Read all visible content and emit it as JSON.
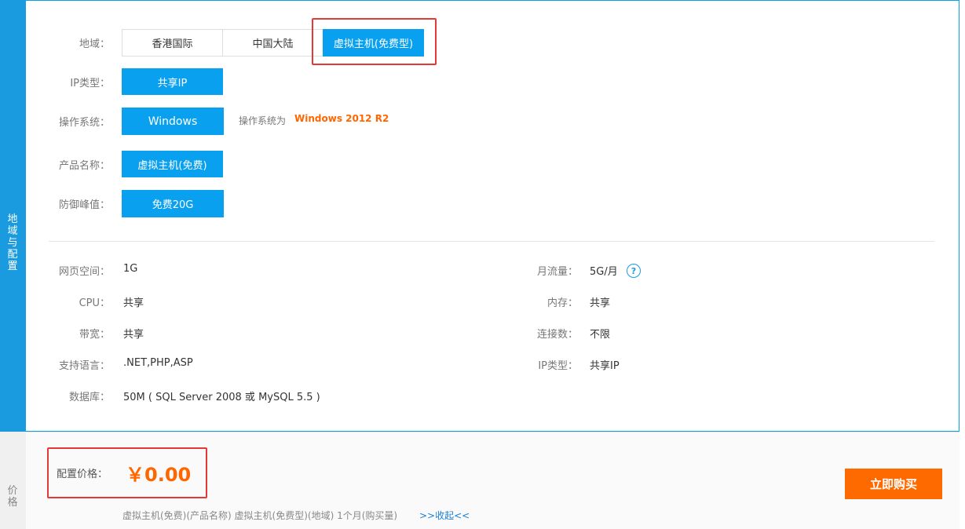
{
  "side_tabs": {
    "config": "地域与配置",
    "price": "价格"
  },
  "region": {
    "label": "地域：",
    "options": [
      "香港国际",
      "中国大陆",
      "虚拟主机(免费型)"
    ],
    "selected": "虚拟主机(免费型)"
  },
  "ip_type": {
    "label": "IP类型：",
    "option": "共享IP"
  },
  "os": {
    "label": "操作系统：",
    "option": "Windows",
    "note": "操作系统为",
    "version": "Windows 2012 R2"
  },
  "product": {
    "label": "产品名称：",
    "option": "虚拟主机(免费)"
  },
  "defense": {
    "label": "防御峰值：",
    "option": "免费20G"
  },
  "specs_left": [
    {
      "label": "网页空间：",
      "value": "1G"
    },
    {
      "label": "CPU：",
      "value": "共享"
    },
    {
      "label": "带宽：",
      "value": "共享"
    },
    {
      "label": "支持语言：",
      "value": ".NET,PHP,ASP"
    },
    {
      "label": "数据库：",
      "value": "50M ( SQL Server 2008 或 MySQL 5.5 )"
    }
  ],
  "specs_right": [
    {
      "label": "月流量：",
      "value": "5G/月"
    },
    {
      "label": "内存：",
      "value": "共享"
    },
    {
      "label": "连接数：",
      "value": "不限"
    },
    {
      "label": "IP类型：",
      "value": "共享IP"
    }
  ],
  "help_icon": "question-circle-icon",
  "price": {
    "label": "配置价格：",
    "value": "￥0.00"
  },
  "summary": "虚拟主机(免费)(产品名称)  虚拟主机(免费型)(地域)  1个月(购买量)",
  "collapse_link": ">>收起<<",
  "buy_button": "立即购买",
  "colors": {
    "accent_blue": "#0aa0f0",
    "price_orange": "#ff6600",
    "buy_orange": "#ff6a00",
    "highlight_red": "#e53935"
  }
}
